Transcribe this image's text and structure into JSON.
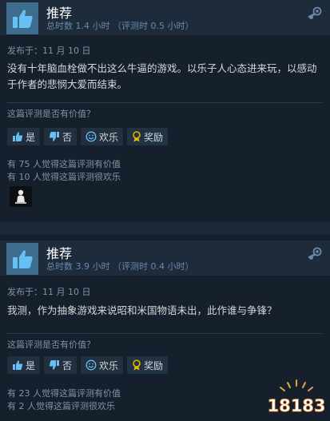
{
  "reviews": [
    {
      "verdict": "推荐",
      "hours": "总时数 1.4 小时 （评测时 0.5 小时）",
      "posted": "发布于：11 月 10 日",
      "text": "没有十年脑血栓做不出这么牛逼的游戏。以乐子人心态进来玩，以感动于作者的悲悯大爱而结束。",
      "question": "这篇评测是否有价值？",
      "buttons": {
        "yes": "是",
        "no": "否",
        "funny": "欢乐",
        "award": "奖励"
      },
      "helpful_count": "有 75 人觉得这篇评测有价值",
      "funny_count": "有 10 人觉得这篇评测很欢乐"
    },
    {
      "verdict": "推荐",
      "hours": "总时数 3.9 小时 （评测时 0.4 小时）",
      "posted": "发布于：11 月 10 日",
      "text": "我测，作为抽象游戏来说昭和米国物语未出，此作谁与争锋？",
      "question": "这篇评测是否有价值？",
      "buttons": {
        "yes": "是",
        "no": "否",
        "funny": "欢乐",
        "award": "奖励"
      },
      "helpful_count": "有 23 人觉得这篇评测有价值",
      "funny_count": "有 2 人觉得这篇评测很欢乐"
    }
  ],
  "watermark": "18183",
  "colors": {
    "page_bg": "#1b2838",
    "review_bg": "#16202d",
    "header_bg": "#1d2b3b",
    "thumb_bg": "#3d6c8d",
    "accent_icon": "#66c0f4",
    "award_icon": "#e4b400"
  }
}
